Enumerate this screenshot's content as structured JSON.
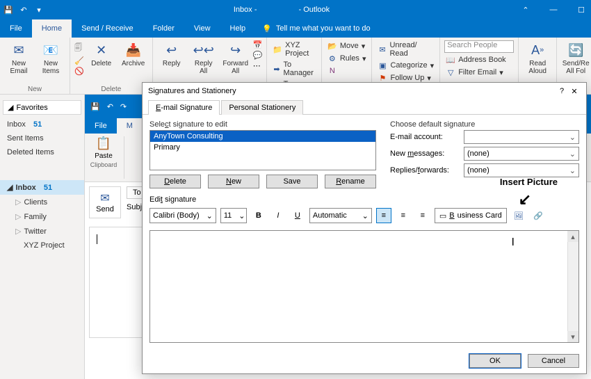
{
  "titlebar": {
    "left_doc": "Inbox -",
    "app": "- Outlook"
  },
  "tabs": {
    "file": "File",
    "home": "Home",
    "sendreceive": "Send / Receive",
    "folder": "Folder",
    "view": "View",
    "help": "Help",
    "tellme": "Tell me what you want to do"
  },
  "ribbon": {
    "new": {
      "email": "New\nEmail",
      "items": "New\nItems",
      "group": "New"
    },
    "delete": {
      "delete": "Delete",
      "archive": "Archive",
      "group": "Delete"
    },
    "respond": {
      "reply": "Reply",
      "replyall": "Reply\nAll",
      "forward": "Forward\nAll"
    },
    "quicksteps": {
      "a": "XYZ Project",
      "b": "To Manager",
      "c": "Team Email"
    },
    "move": {
      "move": "Move",
      "rules": "Rules"
    },
    "tags": {
      "unread": "Unread/ Read",
      "categorize": "Categorize",
      "followup": "Follow Up"
    },
    "find": {
      "search_ph": "Search People",
      "ab": "Address Book",
      "filter": "Filter Email"
    },
    "speech": {
      "read": "Read\nAloud"
    },
    "sendrcv": {
      "label": "Send/Re\nAll Fol"
    }
  },
  "nav": {
    "favorites": "Favorites",
    "inbox": "Inbox",
    "inbox_count": "51",
    "sent": "Sent Items",
    "deleted": "Deleted Items",
    "inbox2": "Inbox",
    "inbox2_count": "51",
    "clients": "Clients",
    "family": "Family",
    "twitter": "Twitter",
    "xyz": "XYZ Project"
  },
  "compose": {
    "file": "File",
    "m": "M",
    "paste": "Paste",
    "clipboard": "Clipboard",
    "send": "Send",
    "to": "To",
    "subj": "Subj"
  },
  "dialog": {
    "title": "Signatures and Stationery",
    "tab_email": "E-mail Signature",
    "tab_stationery": "Personal Stationery",
    "select_lbl": "Select signature to edit",
    "sig1": "AnyTown Consulting",
    "sig2": "Primary",
    "choose_lbl": "Choose default signature",
    "email_account": "E-mail account:",
    "new_messages": "New messages:",
    "new_messages_val": "(none)",
    "replies": "Replies/forwards:",
    "replies_val": "(none)",
    "btn_delete": "Delete",
    "btn_new": "New",
    "btn_save": "Save",
    "btn_rename": "Rename",
    "edit_lbl": "Edit signature",
    "font": "Calibri (Body)",
    "size": "11",
    "auto": "Automatic",
    "bizcard": "Business Card",
    "ok": "OK",
    "cancel": "Cancel"
  },
  "annotation": "Insert Picture"
}
